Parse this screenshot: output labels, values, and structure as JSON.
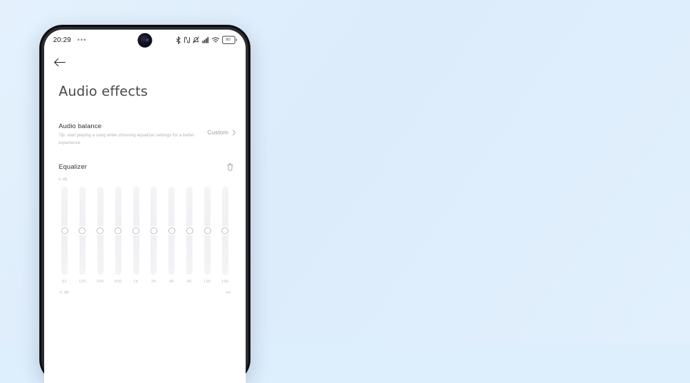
{
  "theme": {
    "page_background": "#dfeffc",
    "phone_frame": "#0c0c0e",
    "screen_background": "#ffffff",
    "primary_text": "#2e2e31",
    "muted_text": "#b2b2b8",
    "track_color": "#f1f2f4",
    "thumb_border": "#b9bcc4"
  },
  "status_bar": {
    "time": "20:29",
    "overflow_dots": "•••",
    "icons": [
      "bluetooth-icon",
      "nfc-icon",
      "silent-mode-icon",
      "cellular-signal-icon",
      "wifi-icon"
    ],
    "battery_level": "90"
  },
  "app": {
    "back_label": "Back",
    "title": "Audio effects",
    "audio_balance": {
      "title": "Audio balance",
      "tip": "Tip: start playing a song while choosing equalizer settings for a better experience",
      "value": "Custom"
    },
    "equalizer": {
      "title": "Equalizer",
      "reset_label": "Reset",
      "max_label": "6 dB",
      "min_label": "-6 dB",
      "unit_label": "Hz",
      "bands": [
        {
          "freq": "62",
          "gain_pct": 50
        },
        {
          "freq": "125",
          "gain_pct": 50
        },
        {
          "freq": "250",
          "gain_pct": 50
        },
        {
          "freq": "500",
          "gain_pct": 50
        },
        {
          "freq": "1K",
          "gain_pct": 50
        },
        {
          "freq": "2K",
          "gain_pct": 50
        },
        {
          "freq": "4K",
          "gain_pct": 50
        },
        {
          "freq": "8K",
          "gain_pct": 50
        },
        {
          "freq": "12K",
          "gain_pct": 50
        },
        {
          "freq": "16K",
          "gain_pct": 50
        }
      ]
    }
  }
}
